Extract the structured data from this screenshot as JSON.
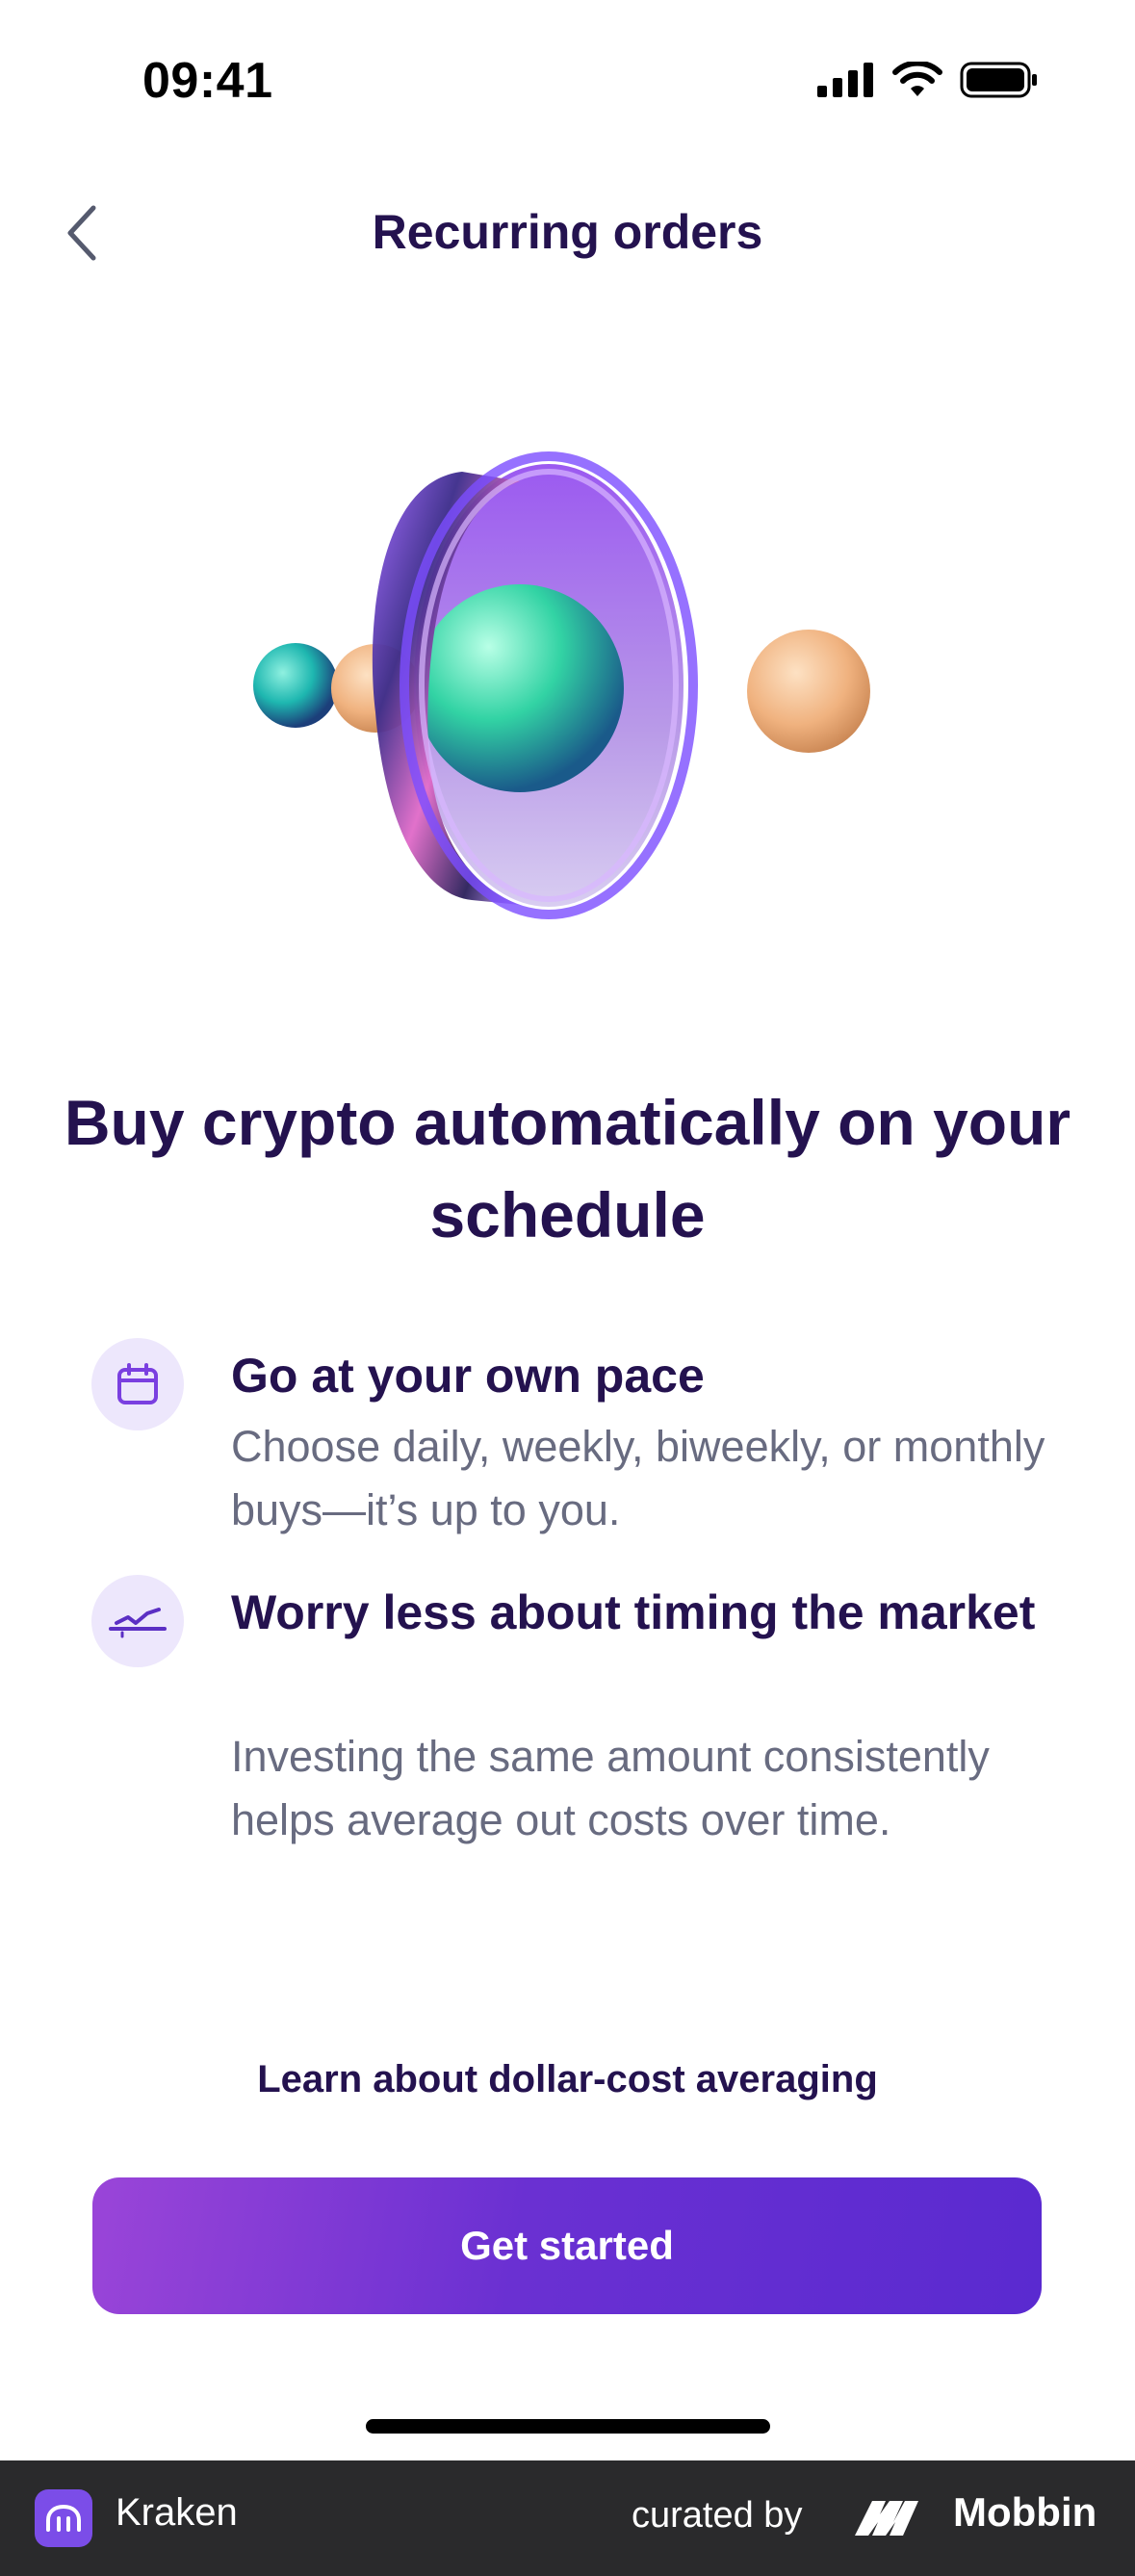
{
  "status_bar": {
    "time": "09:41",
    "icons": [
      "cellular-signal-icon",
      "wifi-icon",
      "battery-icon"
    ]
  },
  "nav": {
    "back_icon": "chevron-left-icon",
    "title": "Recurring orders"
  },
  "hero": {
    "illustration": "crypto-ring-spheres-illustration"
  },
  "headline": "Buy crypto automatically on your schedule",
  "features": [
    {
      "icon": "calendar-icon",
      "title": "Go at your own pace",
      "description": "Choose daily, weekly, biweekly, or monthly buys—it’s up to you."
    },
    {
      "icon": "trend-line-icon",
      "title": "Worry less about timing the market",
      "description": "Investing the same amount consistently helps average out costs over time."
    }
  ],
  "learn_link": "Learn about dollar-cost averaging",
  "cta_label": "Get started",
  "footer": {
    "app_name": "Kraken",
    "curated_by": "curated by",
    "brand": "Mobbin"
  },
  "colors": {
    "primary_text": "#24124f",
    "secondary_text": "#686b80",
    "accent": "#6a30d2",
    "icon_bg": "#ede7fc",
    "footer_bg": "#2a2a2c"
  }
}
